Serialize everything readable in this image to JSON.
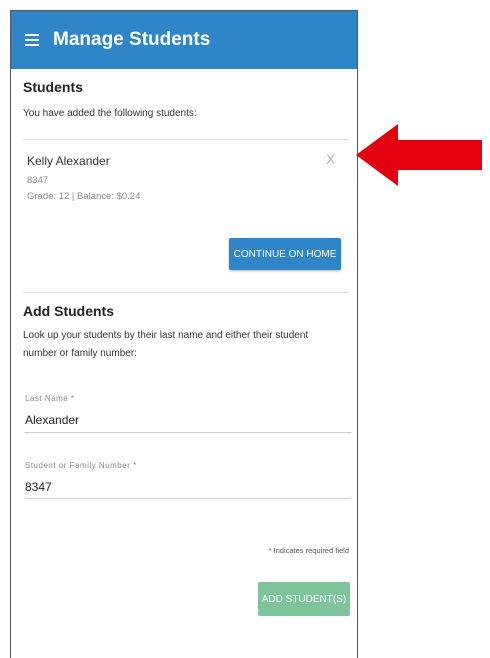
{
  "appbar": {
    "title": "Manage Students",
    "menu_icon": "hamburger-menu-icon"
  },
  "students_section": {
    "title": "Students",
    "subtitle": "You have added the following students:",
    "students": [
      {
        "name": "Kelly Alexander",
        "number": "8347",
        "details": "Grade: 12 | Balance: $0.24",
        "remove_label": "X"
      }
    ],
    "continue_button": "CONTINUE ON HOME"
  },
  "add_section": {
    "title": "Add Students",
    "description": "Look up your students by their last name and either their student number or family number:",
    "last_name": {
      "label": "Last Name *",
      "value": "Alexander"
    },
    "student_number": {
      "label": "Student or Family Number *",
      "value": "8347"
    },
    "required_note": "* Indicates required field",
    "add_button": "ADD STUDENT(S)"
  },
  "colors": {
    "appbar": "#2e86c9",
    "continue_button": "#2e86c9",
    "add_button": "#7dc49a",
    "arrow": "#e3000f"
  },
  "annotation": {
    "icon": "red-arrow-icon"
  }
}
